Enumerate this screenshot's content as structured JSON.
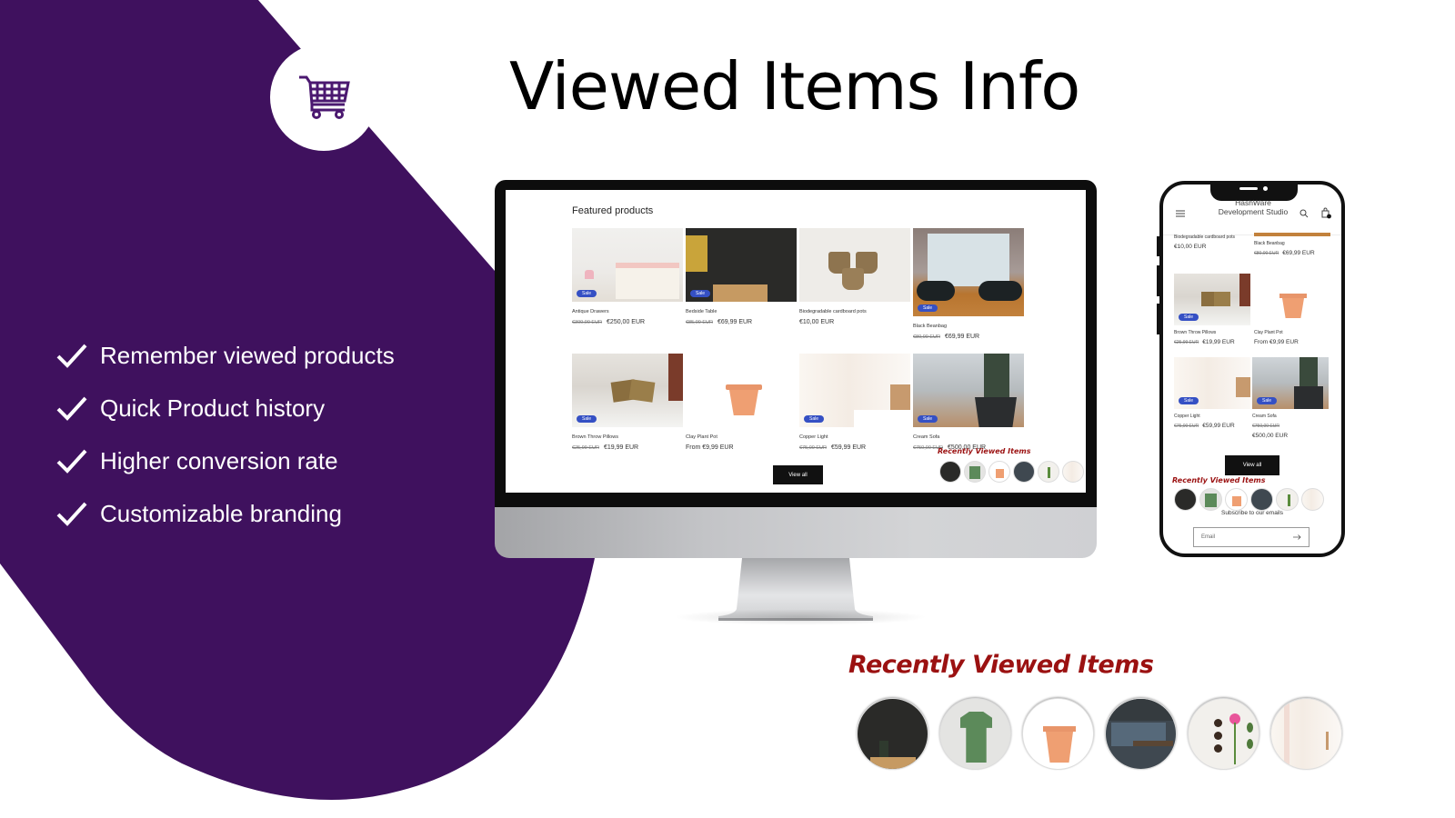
{
  "page": {
    "title": "Viewed Items Info",
    "brand_color": "#3f115e",
    "accent_color": "#9b1111",
    "sale_badge_color": "#3550c4"
  },
  "badge": {
    "icon": "shopping-cart-icon"
  },
  "features": [
    {
      "icon": "checkmark-icon",
      "label": "Remember viewed products"
    },
    {
      "icon": "checkmark-icon",
      "label": "Quick Product history"
    },
    {
      "icon": "checkmark-icon",
      "label": "Higher conversion rate"
    },
    {
      "icon": "checkmark-icon",
      "label": "Customizable branding"
    }
  ],
  "desktop": {
    "section_title": "Featured products",
    "products": [
      {
        "name": "Antique Drawers",
        "old_price": "€300,00 EUR",
        "price": "€250,00 EUR",
        "sale": true,
        "badge": "Sale"
      },
      {
        "name": "Bedside Table",
        "old_price": "€85,00 EUR",
        "price": "€69,99 EUR",
        "sale": true,
        "badge": "Sale"
      },
      {
        "name": "Biodegradable cardboard pots",
        "old_price": "",
        "price": "€10,00 EUR",
        "sale": false,
        "badge": ""
      },
      {
        "name": "Black Beanbag",
        "old_price": "€80,00 EUR",
        "price": "€69,99 EUR",
        "sale": true,
        "badge": "Sale"
      },
      {
        "name": "Brown Throw Pillows",
        "old_price": "€25,99 EUR",
        "price": "€19,99 EUR",
        "sale": true,
        "badge": "Sale"
      },
      {
        "name": "Clay Plant Pot",
        "old_price": "",
        "price": "From €9,99 EUR",
        "sale": false,
        "badge": ""
      },
      {
        "name": "Copper Light",
        "old_price": "€75,00 EUR",
        "price": "€59,99 EUR",
        "sale": true,
        "badge": "Sale"
      },
      {
        "name": "Cream Sofa",
        "old_price": "€750,00 EUR",
        "price": "€500,00 EUR",
        "sale": true,
        "badge": "Sale"
      }
    ],
    "view_all_label": "View all",
    "recently_viewed_title": "Recently Viewed Items"
  },
  "mobile": {
    "brand": "HashWare Development Studio",
    "menu_icon": "hamburger-menu-icon",
    "search_icon": "search-icon",
    "cart_icon": "shopping-bag-icon",
    "products": [
      {
        "name": "Biodegradable cardboard pots",
        "old_price": "",
        "price": "€10,00 EUR"
      },
      {
        "name": "Black Beanbag",
        "old_price": "€80,00 EUR",
        "price": "€69,99 EUR"
      },
      {
        "name": "Brown Throw Pillows",
        "old_price": "€25,99 EUR",
        "price": "€19,99 EUR",
        "badge": "Sale"
      },
      {
        "name": "Clay Plant Pot",
        "old_price": "",
        "price": "From €9,99 EUR"
      },
      {
        "name": "Copper Light",
        "old_price": "€75,00 EUR",
        "price": "€59,99 EUR",
        "badge": "Sale"
      },
      {
        "name": "Cream Sofa",
        "old_price": "€750,00 EUR",
        "price": "€500,00 EUR",
        "badge": "Sale"
      }
    ],
    "view_all_label": "View all",
    "recently_viewed_title": "Recently Viewed Items",
    "subscribe_label": "Subscribe to our emails",
    "email_placeholder": "Email",
    "submit_icon": "arrow-right-icon"
  },
  "recently_viewed": {
    "title": "Recently Viewed Items",
    "items": [
      {
        "label": "Bedside Table"
      },
      {
        "label": "Green T-Shirt"
      },
      {
        "label": "Clay Plant Pot"
      },
      {
        "label": "Grey Sofa"
      },
      {
        "label": "Flower Pots"
      },
      {
        "label": "Copper Light"
      }
    ]
  }
}
